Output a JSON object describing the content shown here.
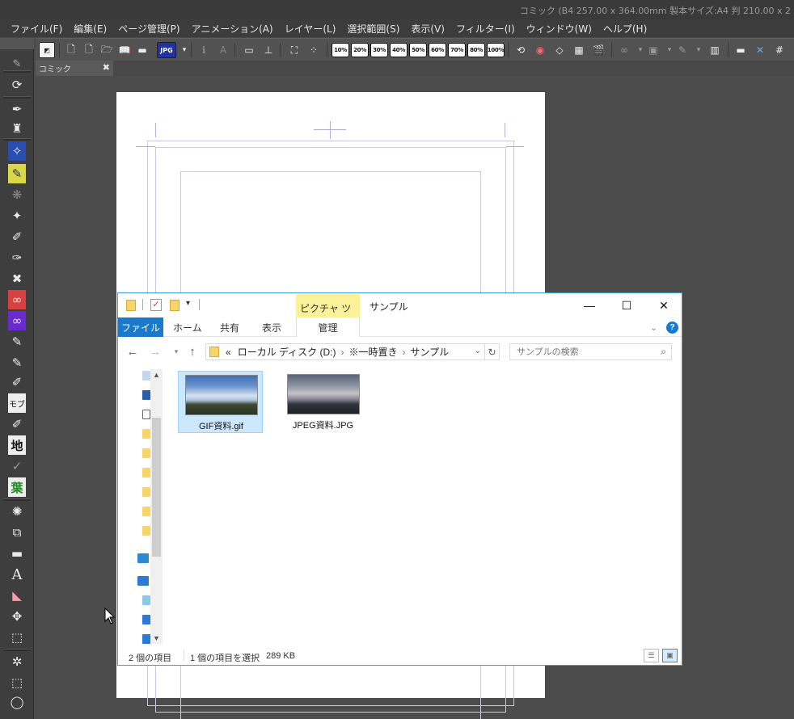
{
  "app": {
    "title": "コミック (B4 257.00 x 364.00mm 製本サイズ:A4 判 210.00 x 2"
  },
  "menu": [
    "ファイル(F)",
    "編集(E)",
    "ページ管理(P)",
    "アニメーション(A)",
    "レイヤー(L)",
    "選択範囲(S)",
    "表示(V)",
    "フィルター(I)",
    "ウィンドウ(W)",
    "ヘルプ(H)"
  ],
  "toolbar": {
    "jpg_label": "JPG",
    "zoom_levels": [
      "10%",
      "20%",
      "30%",
      "40%",
      "50%",
      "60%",
      "70%",
      "80%",
      "100%"
    ]
  },
  "tool_palette": {
    "mob_label": "モブ",
    "ground_label": "地",
    "leaf_label": "葉",
    "text_tool": "A"
  },
  "document": {
    "tab_label": "コミック",
    "tab_close": "✖"
  },
  "explorer": {
    "window_title": "サンプル",
    "picture_tools": "ピクチャ ツール",
    "ribbon_tabs": [
      "ファイル",
      "ホーム",
      "共有",
      "表示"
    ],
    "manage_tab": "管理",
    "minimize": "—",
    "maximize": "☐",
    "close": "✕",
    "address": {
      "prefix": "«",
      "path": [
        "ローカル ディスク (D:)",
        "※一時置き",
        "サンプル"
      ],
      "separator": "›"
    },
    "search_placeholder": "サンプルの検索",
    "files": [
      {
        "name": "GIF資料.gif",
        "selected": true
      },
      {
        "name": "JPEG資料.JPG",
        "selected": false
      }
    ],
    "status": {
      "count": "2 個の項目",
      "selection": "1 個の項目を選択",
      "size": "289 KB"
    }
  },
  "colors": {
    "app_bg": "#4a4a4a",
    "file_tab": "#1979ca",
    "picture_tools_bg": "#fbf199",
    "selection": "#cce8ff",
    "window_border": "#3aa0d6"
  }
}
